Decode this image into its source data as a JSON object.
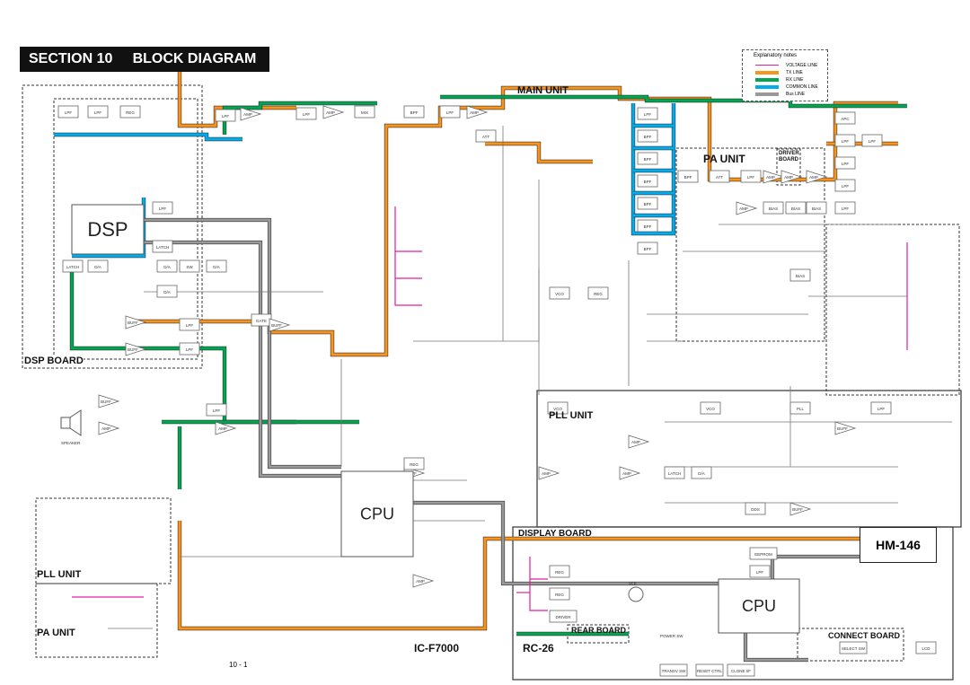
{
  "header": {
    "section": "SECTION 10",
    "title": "BLOCK DIAGRAM"
  },
  "legend": {
    "title": "Explanatory notes",
    "items": [
      {
        "label": "VOLTAGE LINE",
        "color": "#e0209a"
      },
      {
        "label": "TX LINE",
        "color": "#f7941d"
      },
      {
        "label": "RX LINE",
        "color": "#00a650"
      },
      {
        "label": "COMMON LINE",
        "color": "#00aeef"
      },
      {
        "label": "Bus LINE",
        "color": "#9a9a9a"
      }
    ]
  },
  "boards": {
    "main_unit": "MAIN UNIT",
    "dsp_board": "DSP BOARD",
    "pa_unit": "PA UNIT",
    "driver_board": "DRIVER BOARD",
    "pll_unit": "PLL UNIT",
    "pll_unit_sub": "PLL UNIT",
    "pa_unit_sub": "PA UNIT",
    "display_board": "DISPLAY BOARD",
    "rear_board": "REAR BOARD",
    "connect_board": "CONNECT BOARD",
    "hm146": "HM-146",
    "model_main": "IC-F7000",
    "model_rc": "RC-26"
  },
  "blocks": {
    "dsp": "DSP",
    "cpu_main": "CPU",
    "cpu_display": "CPU",
    "items": [
      "LPF",
      "LPF",
      "REG",
      "LPF",
      "AMP",
      "LPF",
      "AMP",
      "MIX",
      "BPF",
      "LPF",
      "AMP",
      "ATT",
      "LPF",
      "BPF",
      "BPF",
      "BPF",
      "BPF",
      "BPF",
      "BPF",
      "BPF",
      "ATT",
      "LPF",
      "AMP",
      "AMP",
      "AMP",
      "AMP",
      "BIAS",
      "BIAS",
      "BIAS",
      "BIAS",
      "APC",
      "LPF",
      "LPF",
      "LPF",
      "LPF",
      "LPF",
      "LPF",
      "LATCH",
      "LATCH",
      "D/A",
      "D/A",
      "D/A",
      "D/A",
      "SW",
      "BUFF",
      "LPF",
      "BUFF",
      "LPF",
      "BUFF",
      "AMP",
      "AMP",
      "LPF",
      "GATE",
      "VCO",
      "VCO",
      "PLL",
      "LPF",
      "BUFF",
      "AMP",
      "D/A",
      "DDS",
      "BUFF",
      "REG",
      "REG",
      "REG",
      "DRIVER",
      "LCD",
      "SELECT SW",
      "TRANSV SW",
      "RESET CTRL",
      "CLONE I/F",
      "EEPROM",
      "LPF",
      "AMP",
      "BUFF",
      "REG",
      "VCO",
      "AMP",
      "LATCH",
      "BUFF",
      "AMP"
    ]
  },
  "texts": {
    "page_number": "10 - 1",
    "vol": "VOL",
    "power_sw": "POWER SW",
    "speaker": "SPEAKER"
  }
}
